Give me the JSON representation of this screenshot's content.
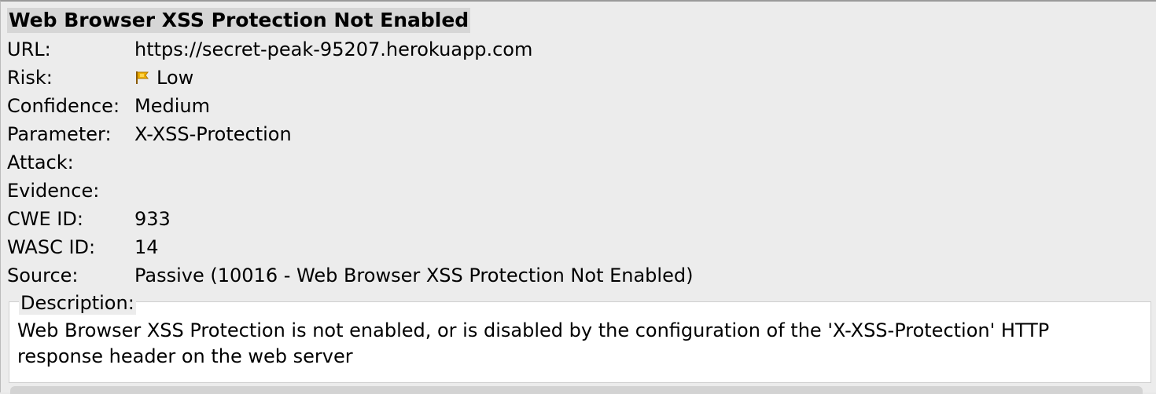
{
  "alert": {
    "title": "Web Browser XSS Protection Not Enabled",
    "fields": [
      {
        "label": "URL:",
        "value": "https://secret-peak-95207.herokuapp.com"
      },
      {
        "label": "Risk:",
        "value": "Low",
        "icon": "low-risk-flag-icon"
      },
      {
        "label": "Confidence:",
        "value": "Medium"
      },
      {
        "label": "Parameter:",
        "value": "X-XSS-Protection"
      },
      {
        "label": "Attack:",
        "value": ""
      },
      {
        "label": "Evidence:",
        "value": ""
      },
      {
        "label": "CWE ID:",
        "value": "933"
      },
      {
        "label": "WASC ID:",
        "value": "14"
      },
      {
        "label": "Source:",
        "value": "Passive (10016 - Web Browser XSS Protection Not Enabled)"
      }
    ],
    "description": {
      "legend": "Description:",
      "text": "Web Browser XSS Protection is not enabled, or is disabled by the configuration of the 'X-XSS-Protection' HTTP response header on the web server"
    }
  },
  "colors": {
    "risk_flag": "#e6a400",
    "background": "#ececec",
    "panel": "#ffffff"
  }
}
